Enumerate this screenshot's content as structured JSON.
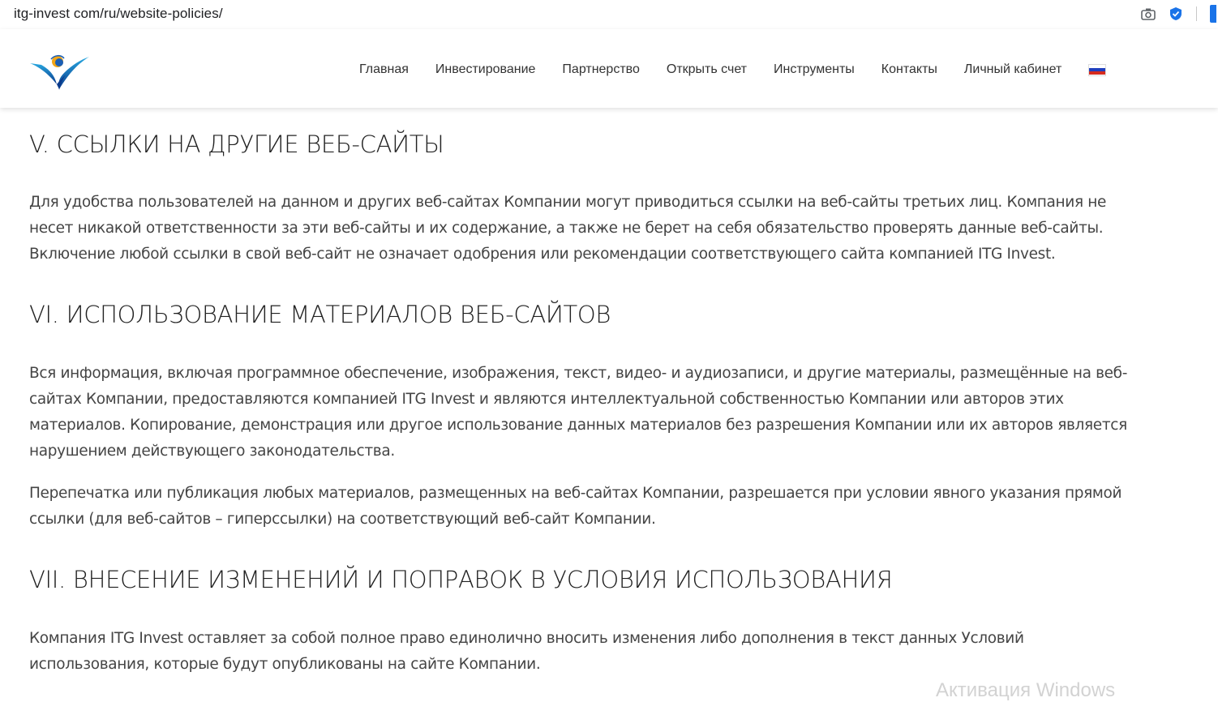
{
  "browser": {
    "url": "itg-invest com/ru/website-policies/"
  },
  "header": {
    "nav": [
      {
        "label": "Главная"
      },
      {
        "label": "Инвестирование"
      },
      {
        "label": "Партнерство"
      },
      {
        "label": "Открыть счет"
      },
      {
        "label": "Инструменты"
      },
      {
        "label": "Контакты"
      },
      {
        "label": "Личный кабинет"
      }
    ],
    "flag_colors": [
      "#ffffff",
      "#1f3fbf",
      "#d52b1e"
    ]
  },
  "sections": [
    {
      "heading": "V. ССЫЛКИ НА ДРУГИЕ ВЕБ-САЙТЫ",
      "paragraphs": [
        "Для удобства пользователей на данном и других веб-сайтах Компании могут приводиться ссылки на веб-сайты третьих лиц. Компания  не несет никакой ответственности за эти веб-сайты и их содержание, а также не берет на себя обязательство проверять данные веб-сайты. Включение любой ссылки в свой веб-сайт не означает одобрения или рекомендации соответствующего сайта компанией ITG Invest."
      ]
    },
    {
      "heading": "VI. ИСПОЛЬЗОВАНИЕ МАТЕРИАЛОВ ВЕБ-САЙТОВ",
      "paragraphs": [
        "Вся информация, включая программное обеспечение, изображения, текст, видео- и аудиозаписи, и другие материалы, размещённые на веб-сайтах Компании, предоставляются компанией ITG Invest и являются интеллектуальной собственностью Компании или авторов этих материалов. Копирование, демонстрация или другое использование данных материалов без разрешения Компании или их авторов является нарушением действующего законодательства.",
        "Перепечатка или публикация любых материалов, размещенных на веб-сайтах Компании, разрешается при условии явного указания прямой ссылки (для веб-сайтов – гиперссылки) на соответствующий веб-сайт Компании."
      ]
    },
    {
      "heading": "VII. ВНЕСЕНИЕ ИЗМЕНЕНИЙ И ПОПРАВОК В УСЛОВИЯ ИСПОЛЬЗОВАНИЯ",
      "paragraphs": [
        "Компания ITG Invest оставляет за собой полное право единолично вносить изменения либо дополнения в текст данных Условий использования, которые будут опубликованы на сайте Компании."
      ]
    }
  ],
  "watermark": "Активация Windows"
}
